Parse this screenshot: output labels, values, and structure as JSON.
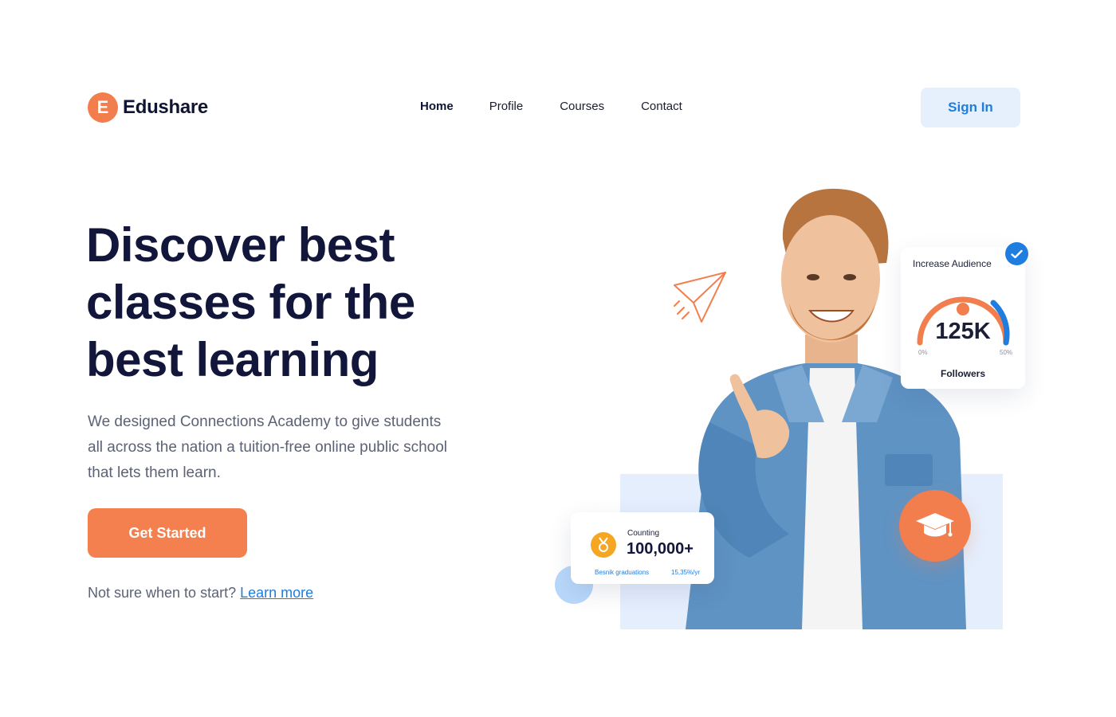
{
  "brand": {
    "logo_letter": "E",
    "name": "Edushare",
    "accent": "#f27e4e",
    "primary_blue": "#1f7de0"
  },
  "nav": {
    "items": [
      {
        "label": "Home",
        "active": true
      },
      {
        "label": "Profile",
        "active": false
      },
      {
        "label": "Courses",
        "active": false
      },
      {
        "label": "Contact",
        "active": false
      }
    ]
  },
  "header": {
    "signin_label": "Sign In"
  },
  "hero": {
    "headline": "Discover best\nclasses for the\nbest  learning",
    "subtext": "We designed Connections Academy to give students all across the nation a tuition-free online public school that lets them learn.",
    "cta_label": "Get Started",
    "learn_prefix": "Not sure when to start?",
    "learn_link": "Learn more"
  },
  "audience_card": {
    "title": "Increase Audience",
    "value": "125K",
    "min_label": "0%",
    "max_label": "50%",
    "label": "Followers",
    "icon": "check-icon"
  },
  "count_card": {
    "label": "Counting",
    "value": "100,000+",
    "footer_left": "Besnik graduations",
    "footer_right": "15,35%/yr",
    "icon": "medal-icon"
  },
  "decor_icons": [
    "paper-plane-icon",
    "graduation-cap-icon"
  ]
}
